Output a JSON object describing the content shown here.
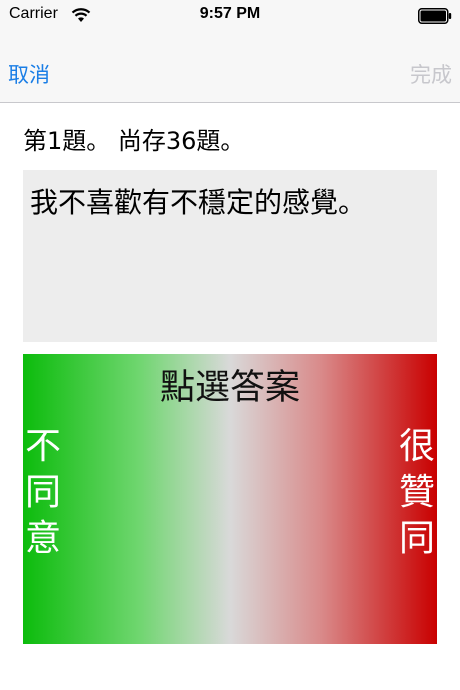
{
  "status_bar": {
    "carrier": "Carrier",
    "time": "9:57 PM"
  },
  "nav": {
    "cancel_label": "取消",
    "done_label": "完成"
  },
  "quiz": {
    "progress": "第1題。 尚存36題。",
    "question": "我不喜歡有不穩定的感覺。"
  },
  "answer_panel": {
    "title": "點選答案",
    "left_label": [
      "不",
      "同",
      "意"
    ],
    "right_label": [
      "很",
      "贊",
      "同"
    ],
    "colors": {
      "disagree": "#0cbc0c",
      "neutral": "#d9d9d9",
      "agree": "#c90000"
    }
  },
  "colors": {
    "accent": "#1a7ee6",
    "disabled": "#c7c7cc"
  }
}
